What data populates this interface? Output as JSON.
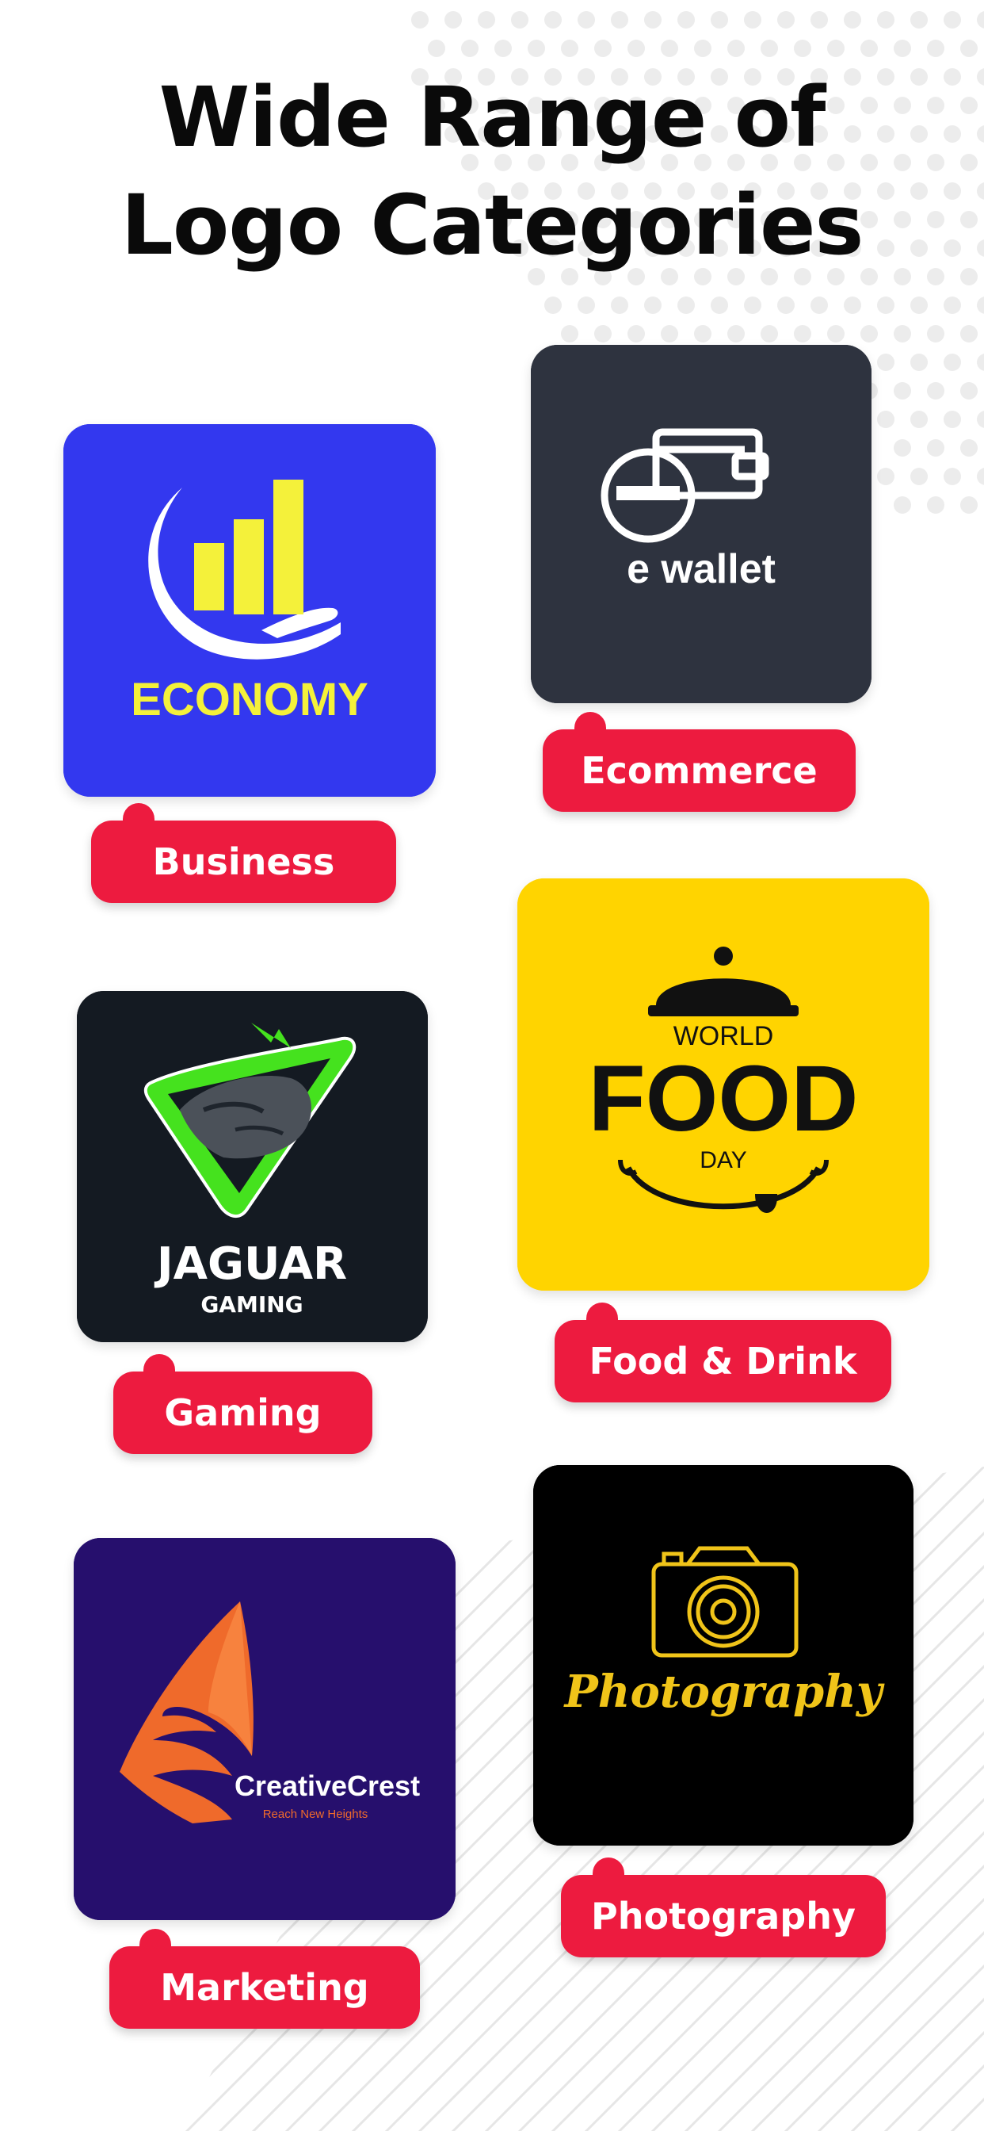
{
  "headline": {
    "line1": "Wide Range of",
    "line2": "Logo Categories"
  },
  "colors": {
    "accent": "#ed1b3f",
    "text": "#0a0a0a"
  },
  "cards": {
    "business": {
      "logo_text": "ECONOMY",
      "label": "Business",
      "bg": "#3338ef"
    },
    "ecommerce": {
      "logo_text": "e wallet",
      "label": "Ecommerce",
      "bg": "#2e333f"
    },
    "food": {
      "logo_top": "WORLD",
      "logo_main": "FOOD",
      "logo_bottom": "DAY",
      "label": "Food & Drink",
      "bg": "#ffd400"
    },
    "gaming": {
      "logo_main": "JAGUAR",
      "logo_sub": "GAMING",
      "label": "Gaming",
      "bg": "#141a22"
    },
    "photography": {
      "logo_text": "Photography",
      "label": "Photography",
      "bg": "#000000"
    },
    "marketing": {
      "logo_main": "CreativeCrest",
      "logo_sub": "Reach New Heights",
      "label": "Marketing",
      "bg": "#260f6d"
    }
  }
}
